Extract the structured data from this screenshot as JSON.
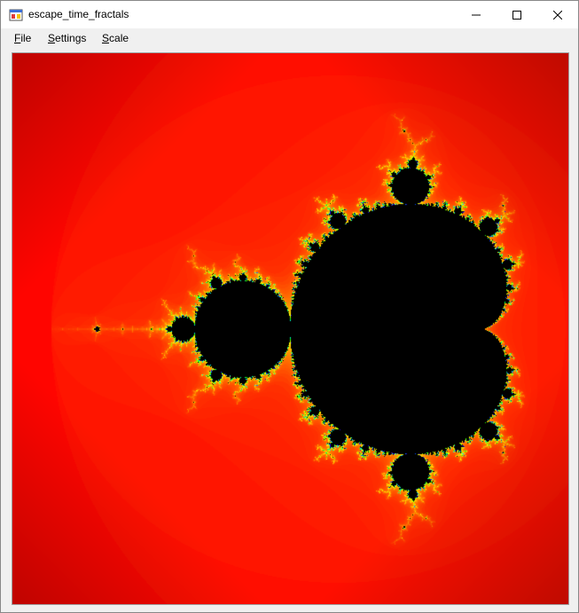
{
  "window": {
    "title": "escape_time_fractals",
    "icon": "app-icon",
    "controls": {
      "minimize_icon": "minimize-icon",
      "maximize_icon": "maximize-icon",
      "close_icon": "close-icon"
    }
  },
  "menu": {
    "items": [
      {
        "label": "File",
        "mnemonic": "F",
        "rest": "ile"
      },
      {
        "label": "Settings",
        "mnemonic": "S",
        "rest": "ettings"
      },
      {
        "label": "Scale",
        "mnemonic": "S",
        "rest": "cale"
      }
    ]
  },
  "fractal": {
    "type": "mandelbrot",
    "colors": {
      "set": "#000000",
      "near": [
        "#4b0082",
        "#0000ff",
        "#00ffff",
        "#00ff00",
        "#ffff00"
      ],
      "far": [
        "#ff0000",
        "#b00000"
      ]
    }
  }
}
